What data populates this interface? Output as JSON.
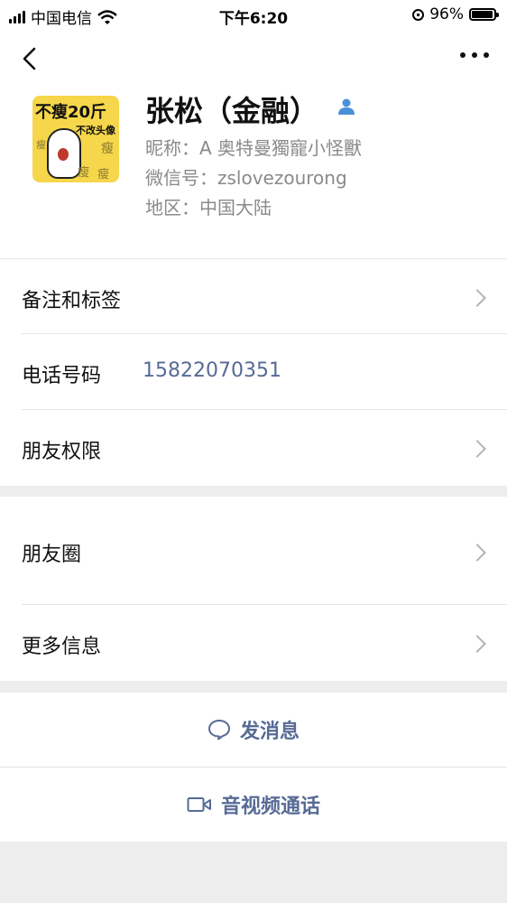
{
  "status_bar": {
    "carrier": "中国电信",
    "time": "下午6:20",
    "battery": "96%",
    "battery_level": 0.96
  },
  "profile": {
    "display_name": "张松（金融）",
    "nickname_line": "昵称：A 奥特曼獨寵小怪獸",
    "wechat_id_line": "微信号：zslovezourong",
    "region_line": "地区：中国大陆",
    "avatar": {
      "caption_main": "不瘦20斤",
      "caption_sub": "不改头像",
      "small_chars": [
        "瘦",
        "瘦",
        "瘦",
        "瘦"
      ]
    }
  },
  "rows": {
    "remark_tags": "备注和标签",
    "phone_label": "电话号码",
    "phone_value": "15822070351",
    "friend_permissions": "朋友权限",
    "moments": "朋友圈",
    "more_info": "更多信息"
  },
  "actions": {
    "message": "发消息",
    "av_call": "音视频通话"
  },
  "colors": {
    "link_blue": "#576b95",
    "background": "#ededed",
    "badge_blue": "#4a90d9"
  }
}
